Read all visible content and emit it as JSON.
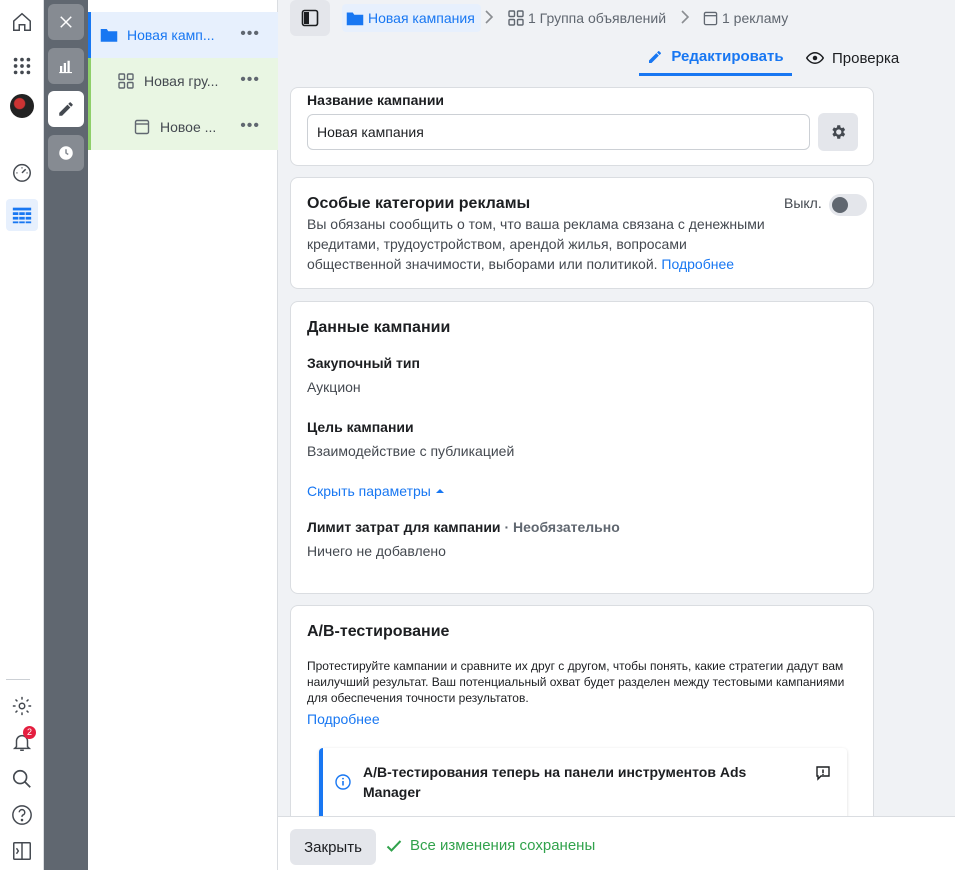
{
  "tree": {
    "campaign": "Новая камп...",
    "adset": "Новая гру...",
    "ad": "Новое ...",
    "more": "•••"
  },
  "breadcrumb": {
    "campaign": "Новая кампания",
    "adset": "1 Группа объявлений",
    "ad": "1 рекламу"
  },
  "tabs": {
    "edit": "Редактировать",
    "review": "Проверка"
  },
  "name_card": {
    "label": "Название кампании",
    "value": "Новая кампания"
  },
  "special": {
    "title": "Особые категории рекламы",
    "toggle_label": "Выкл.",
    "text": "Вы обязаны сообщить о том, что ваша реклама связана с денежными кредитами, трудоустройством, арендой жилья, вопросами общественной значимости, выборами или политикой.",
    "link": "Подробнее"
  },
  "campaign_data": {
    "title": "Данные кампании",
    "buying_label": "Закупочный тип",
    "buying_value": "Аукцион",
    "objective_label": "Цель кампании",
    "objective_value": "Взаимодействие с публикацией",
    "hide_link": "Скрыть параметры",
    "limit_label": "Лимит затрат для кампании",
    "limit_optional": "· Необязательно",
    "limit_value": "Ничего не добавлено"
  },
  "ab": {
    "title": "A/B-тестирование",
    "text": "Протестируйте кампании и сравните их друг с другом, чтобы понять, какие стратегии дадут вам наилучший результат. Ваш потенциальный охват будет разделен между тестовыми кампаниями для обеспечения точности результатов.",
    "link": "Подробнее",
    "notice": "A/B-тестирования теперь на панели инструментов Ads Manager"
  },
  "footer": {
    "close": "Закрыть",
    "saved": "Все изменения сохранены"
  },
  "notifications_count": "2"
}
